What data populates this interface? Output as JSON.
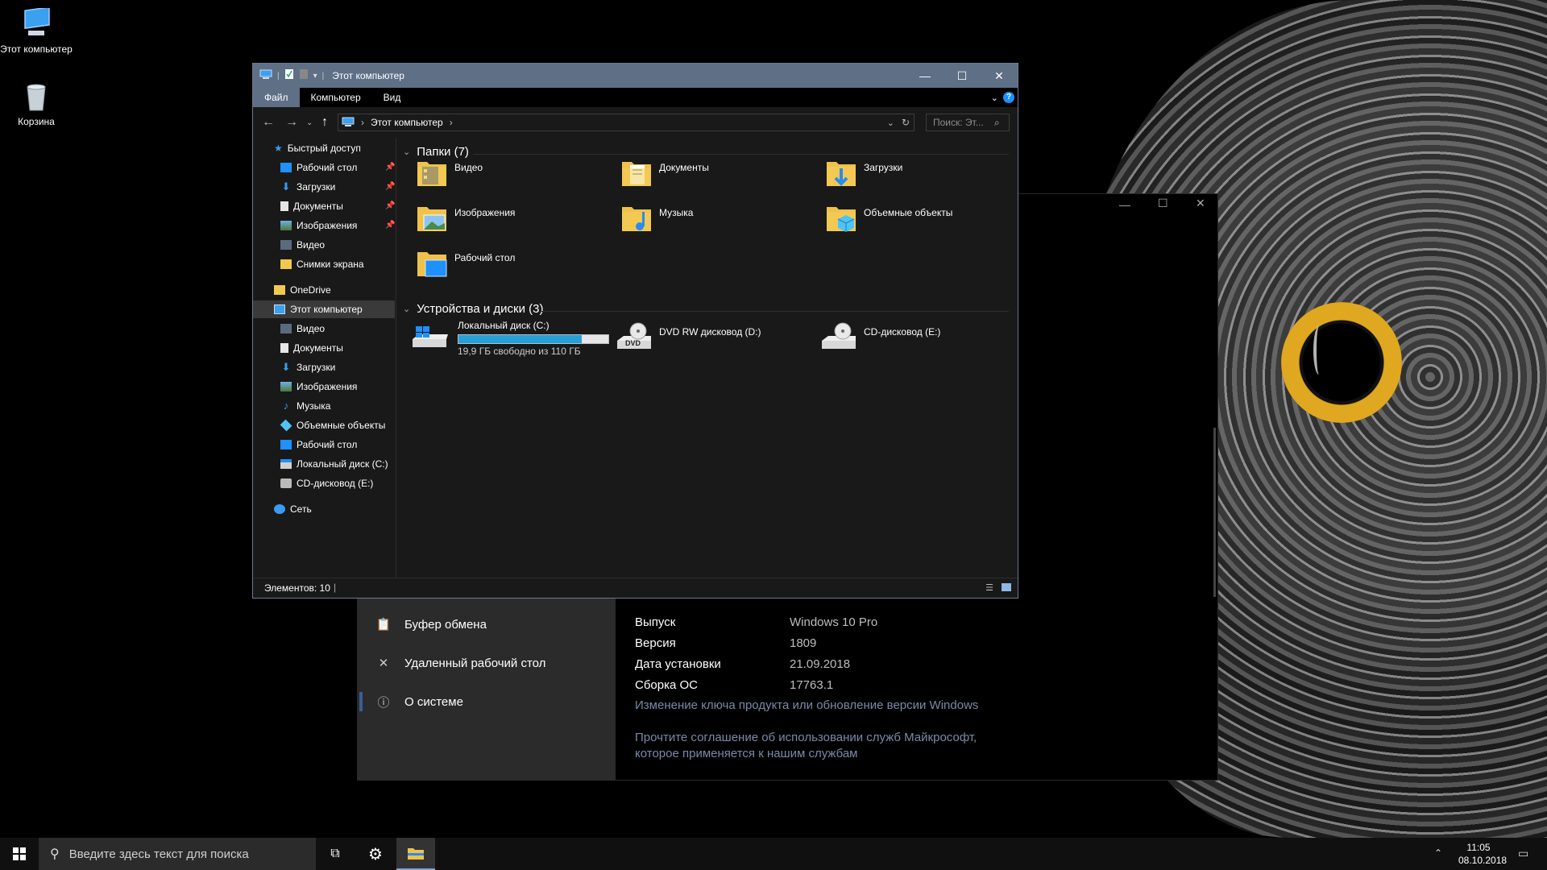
{
  "desktop": {
    "icons": [
      {
        "label": "Этот компьютер"
      },
      {
        "label": "Корзина"
      }
    ]
  },
  "settings_window": {
    "nav": [
      {
        "label": "Буфер обмена",
        "icon": "clipboard-icon"
      },
      {
        "label": "Удаленный рабочий стол",
        "icon": "remote-desktop-icon"
      },
      {
        "label": "О системе",
        "icon": "info-icon",
        "selected": true
      }
    ],
    "specs": [
      {
        "key": "Выпуск",
        "value": "Windows 10 Pro"
      },
      {
        "key": "Версия",
        "value": "1809"
      },
      {
        "key": "Дата установки",
        "value": "21.09.2018"
      },
      {
        "key": "Сборка ОС",
        "value": "17763.1"
      }
    ],
    "link_product_key": "Изменение ключа продукта или обновление версии Windows",
    "link_agreement_line1": "Прочтите соглашение об использовании служб Майкрософт,",
    "link_agreement_line2": "которое применяется к нашим службам"
  },
  "explorer": {
    "title": "Этот компьютер",
    "ribbon_tabs": [
      {
        "label": "Файл",
        "active": true
      },
      {
        "label": "Компьютер"
      },
      {
        "label": "Вид"
      }
    ],
    "address": "Этот компьютер",
    "search_placeholder": "Поиск: Эт...",
    "nav_pane": {
      "quick_access": "Быстрый доступ",
      "quick_items": [
        {
          "label": "Рабочий стол",
          "pinned": true,
          "icon": "desktop-icon"
        },
        {
          "label": "Загрузки",
          "pinned": true,
          "icon": "download-icon"
        },
        {
          "label": "Документы",
          "pinned": true,
          "icon": "document-icon"
        },
        {
          "label": "Изображения",
          "pinned": true,
          "icon": "pictures-icon"
        },
        {
          "label": "Видео",
          "pinned": false,
          "icon": "video-icon"
        },
        {
          "label": "Снимки экрана",
          "pinned": false,
          "icon": "folder-icon"
        }
      ],
      "onedrive": "OneDrive",
      "this_pc": "Этот компьютер",
      "pc_items": [
        {
          "label": "Видео",
          "icon": "video-icon"
        },
        {
          "label": "Документы",
          "icon": "document-icon"
        },
        {
          "label": "Загрузки",
          "icon": "download-icon"
        },
        {
          "label": "Изображения",
          "icon": "pictures-icon"
        },
        {
          "label": "Музыка",
          "icon": "music-icon"
        },
        {
          "label": "Объемные объекты",
          "icon": "3d-objects-icon"
        },
        {
          "label": "Рабочий стол",
          "icon": "desktop-icon"
        },
        {
          "label": "Локальный диск (C:)",
          "icon": "drive-icon"
        },
        {
          "label": "CD-дисковод (E:)",
          "icon": "cd-drive-icon"
        }
      ],
      "network": "Сеть"
    },
    "folders_header": "Папки (7)",
    "folders": [
      {
        "label": "Видео",
        "icon": "video-folder-icon"
      },
      {
        "label": "Документы",
        "icon": "documents-folder-icon"
      },
      {
        "label": "Загрузки",
        "icon": "downloads-folder-icon"
      },
      {
        "label": "Изображения",
        "icon": "pictures-folder-icon"
      },
      {
        "label": "Музыка",
        "icon": "music-folder-icon"
      },
      {
        "label": "Объемные объекты",
        "icon": "3d-objects-folder-icon"
      },
      {
        "label": "Рабочий стол",
        "icon": "desktop-folder-icon"
      }
    ],
    "devices_header": "Устройства и диски (3)",
    "drives": [
      {
        "label": "Локальный диск (C:)",
        "free": "19,9 ГБ свободно из 110 ГБ",
        "used_fraction": 0.82,
        "icon": "windows-drive-icon"
      },
      {
        "label": "DVD RW дисковод (D:)",
        "icon": "dvd-drive-icon",
        "badge": "DVD"
      },
      {
        "label": "CD-дисковод (E:)",
        "icon": "cd-drive-icon"
      }
    ],
    "status": "Элементов: 10"
  },
  "taskbar": {
    "search_placeholder": "Введите здесь текст для поиска",
    "time": "11:05",
    "date": "08.10.2018"
  },
  "colors": {
    "accent": "#5e6f86",
    "drive_fill": "#26a0da",
    "help": "#1e90ff"
  }
}
